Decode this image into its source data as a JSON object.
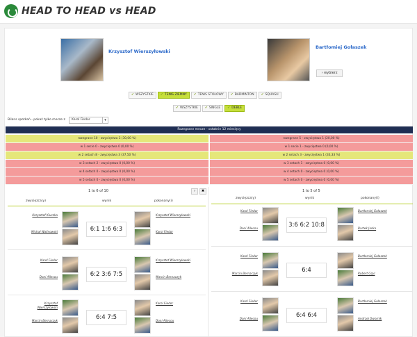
{
  "header": {
    "title": "HEAD TO HEAD vs HEAD"
  },
  "players": [
    {
      "name": "Krzysztof Wierszyłowski"
    },
    {
      "name": "Bartłomiej Gołaszek"
    }
  ],
  "select_button": "wybierz",
  "sport_tabs": [
    {
      "label": "WSZYSTKIE",
      "active": false
    },
    {
      "label": "TENIS ZIEMNY",
      "active": true
    },
    {
      "label": "TENIS STOŁOWY",
      "active": false
    },
    {
      "label": "BADMINTON",
      "active": false
    },
    {
      "label": "SQUASH",
      "active": false
    }
  ],
  "type_tabs": [
    {
      "label": "WSZYSTKIE",
      "active": false
    },
    {
      "label": "SINGLE",
      "active": false
    },
    {
      "label": "DEBLE",
      "active": true
    }
  ],
  "filter": {
    "label": "Bilans spotkań - pokaż tylko mecze z",
    "value": "Karol Fiedor"
  },
  "banner": "Rozegrane mecze - ostatnie 12 miesięcy",
  "stats_left": [
    {
      "text": "rozegrane 10 - zwycięstwa 3 (30,00 %)",
      "tone": "yellow"
    },
    {
      "text": "w 1 secie 0 - zwycięstwa 0 (0,00 %)",
      "tone": "red"
    },
    {
      "text": "w 2 setach 8 - zwycięstwa 3 (37,50 %)",
      "tone": "yellow"
    },
    {
      "text": "w 3 setach 2 - zwycięstwa 0 (0,00 %)",
      "tone": "red"
    },
    {
      "text": "w 4 setach 0 - zwycięstwa 0 (0,00 %)",
      "tone": "red"
    },
    {
      "text": "w 5 setach 0 - zwycięstwa 0 (0,00 %)",
      "tone": "red"
    }
  ],
  "stats_right": [
    {
      "text": "rozegrane 5 - zwycięstwa 1 (20,00 %)",
      "tone": "red"
    },
    {
      "text": "w 1 secie 1 - zwycięstwa 0 (0,00 %)",
      "tone": "red"
    },
    {
      "text": "w 2 setach 3 - zwycięstwa 1 (33,33 %)",
      "tone": "yellow"
    },
    {
      "text": "w 3 setach 1 - zwycięstwa 0 (0,00 %)",
      "tone": "red"
    },
    {
      "text": "w 4 setach 0 - zwycięstwa 0 (0,00 %)",
      "tone": "red"
    },
    {
      "text": "w 5 setach 0 - zwycięstwa 0 (0,00 %)",
      "tone": "red"
    }
  ],
  "left_list": {
    "pager": "1 to 6 of 10",
    "next_btn": "›",
    "close_btn": "✖",
    "col_winners": "zwycięzca(y)",
    "col_result": "wynik",
    "col_losers": "pokonany(i)",
    "matches": [
      {
        "w1": "Krzysztof Kluczka",
        "w2": "Michał Walinowski",
        "score": "6:1 1:6 6:3",
        "l1": "Krzysztof Wierszyłowski",
        "l2": "Karol Fiedor"
      },
      {
        "w1": "Karol Fiedor",
        "w2": "Doni Allecou",
        "score": "6:2 3:6 7:5",
        "l1": "Krzysztof Wierszyłowski",
        "l2": "Marcin Bernaczyk"
      },
      {
        "w1": "Krzysztof Wierszyłowski",
        "w2": "Marcin Bernaczyk",
        "score": "6:4 7:5",
        "l1": "Karol Fiedor",
        "l2": "Doni Allecou"
      }
    ]
  },
  "right_list": {
    "pager": "1 to 5 of 5",
    "col_winners": "zwycięzca(y)",
    "col_result": "wynik",
    "col_losers": "pokonany(i)",
    "matches": [
      {
        "w1": "Karol Fiedor",
        "w2": "Doni Allecou",
        "score": "3:6 6:2 10:8",
        "l1": "Bartłomiej Gołaszek",
        "l2": "Bartek Jaska"
      },
      {
        "w1": "Karol Fiedor",
        "w2": "Marcin Bernaczyk",
        "score": "6:4",
        "l1": "Bartłomiej Gołaszek",
        "l2": "Robert Gzyl"
      },
      {
        "w1": "Karol Fiedor",
        "w2": "Doni Allecou",
        "score": "6:4 6:4",
        "l1": "Bartłomiej Gołaszek",
        "l2": "Andrzej Dworník"
      }
    ]
  },
  "colors": {
    "accent": "#c6df3a",
    "banner": "#1f2e53",
    "loss": "#f49b9b",
    "win": "#e5e77a",
    "link": "#2a68c9"
  }
}
